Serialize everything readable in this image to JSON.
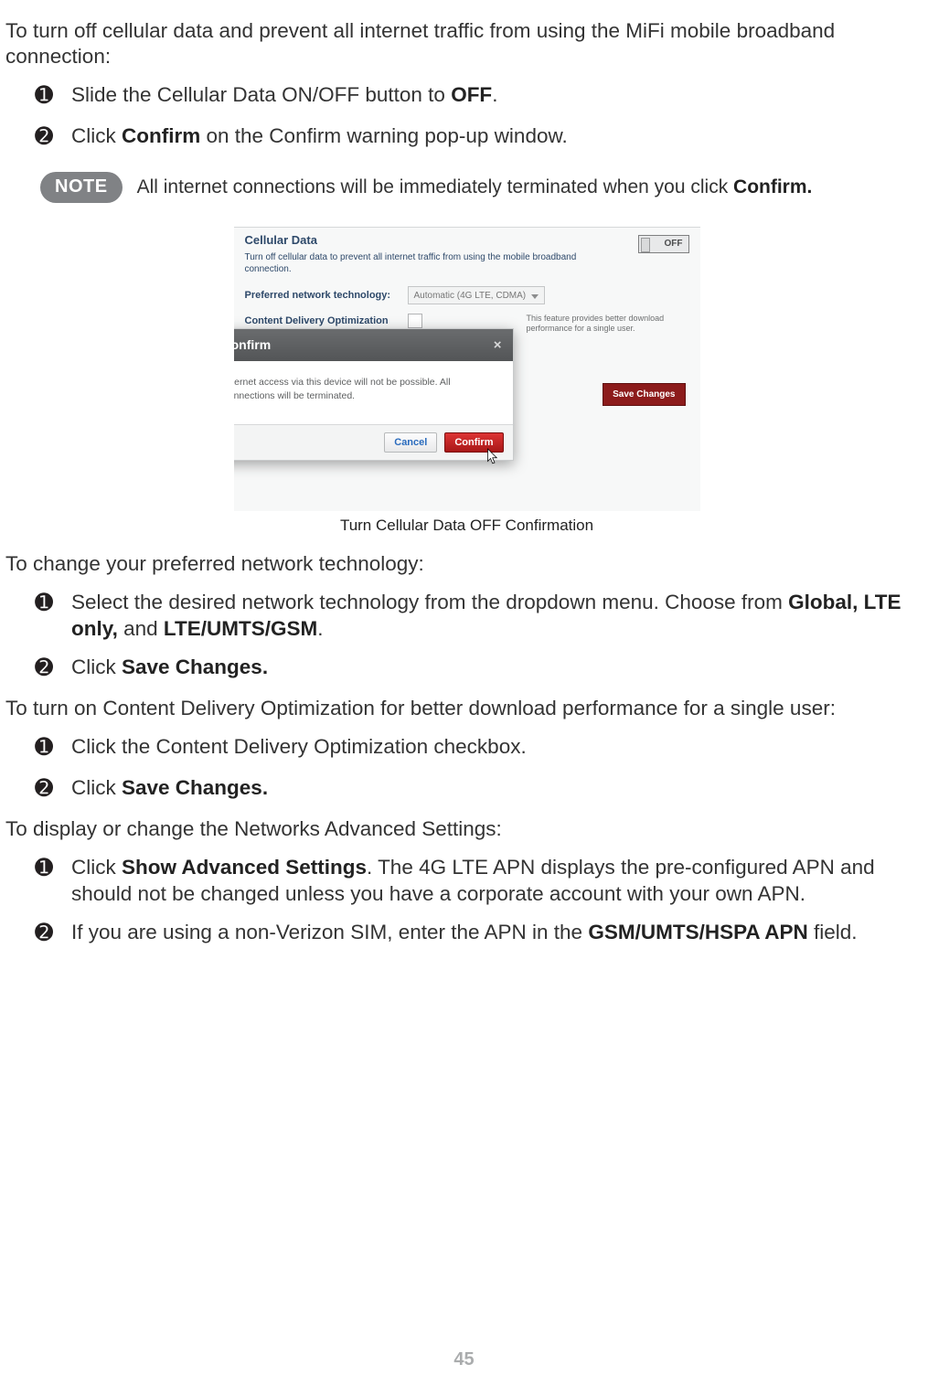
{
  "section1": {
    "intro": "To turn off cellular data and prevent all internet traffic from using the MiFi mobile broadband connection:",
    "step1_pre": "Slide the Cellular Data ON/OFF button to ",
    "step1_bold": "OFF",
    "step1_post": ".",
    "step2_pre": "Click ",
    "step2_bold": "Confirm",
    "step2_post": " on the Confirm warning pop-up window."
  },
  "note": {
    "label": "NOTE",
    "text_pre": "All internet connections will be immediately terminated when you click ",
    "text_bold": "Confirm."
  },
  "screenshot": {
    "panel_title": "Cellular Data",
    "panel_desc": "Turn off cellular data to prevent all internet traffic from using the mobile broadband connection.",
    "toggle_label": "OFF",
    "pref_label": "Preferred network technology:",
    "pref_value": "Automatic (4G LTE, CDMA)",
    "cdo_label": "Content Delivery Optimization",
    "feature_note": "This feature provides better download performance for a single user.",
    "save": "Save Changes",
    "modal_title": "Confirm",
    "modal_body": "Internet access via this device will not be possible. All connections will be terminated.",
    "cancel": "Cancel",
    "confirm": "Confirm",
    "caption": "Turn Cellular Data OFF Confirmation"
  },
  "section2": {
    "intro": "To change your preferred network technology:",
    "step1_pre": "Select the desired network technology from the dropdown menu. Choose from ",
    "step1_b1": "Global, LTE only,",
    "step1_mid": " and ",
    "step1_b2": "LTE/UMTS/GSM",
    "step1_post": ".",
    "step2_pre": "Click ",
    "step2_bold": "Save Changes."
  },
  "section3": {
    "intro": "To turn on Content Delivery Optimization for better download performance for a single user:",
    "step1": "Click the Content Delivery Optimization checkbox.",
    "step2_pre": "Click ",
    "step2_bold": "Save Changes."
  },
  "section4": {
    "intro": "To display or change the Networks Advanced Settings:",
    "step1_pre": "Click ",
    "step1_bold": "Show Advanced Settings",
    "step1_post": ". The 4G LTE APN displays the pre-configured APN and should not be changed unless you have a corporate account with your own APN.",
    "step2_pre": "If you are using a non-Verizon SIM, enter the APN in the ",
    "step2_bold": "GSM/UMTS/HSPA APN",
    "step2_post": " field."
  },
  "bullets": {
    "one": "➊",
    "two": "➋"
  },
  "page_number": "45"
}
